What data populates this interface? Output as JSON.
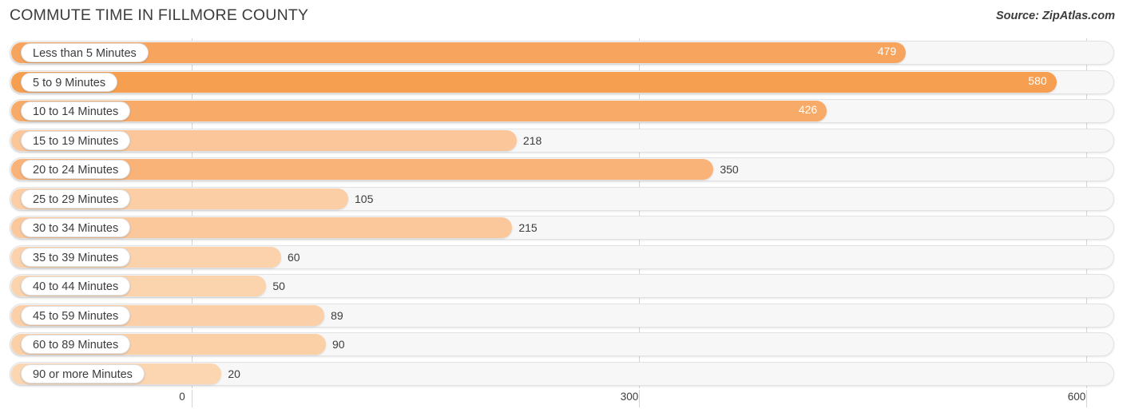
{
  "header": {
    "title": "COMMUTE TIME IN FILLMORE COUNTY",
    "source": "Source: ZipAtlas.com"
  },
  "chart_data": {
    "type": "bar",
    "orientation": "horizontal",
    "title": "COMMUTE TIME IN FILLMORE COUNTY",
    "subtitle": "Source: ZipAtlas.com",
    "xlabel": "",
    "ylabel": "",
    "xlim": [
      0,
      600
    ],
    "xticks": [
      0,
      300,
      600
    ],
    "xtick_labels": [
      "0",
      "300",
      "600"
    ],
    "grid": true,
    "legend": false,
    "categories": [
      "Less than 5 Minutes",
      "5 to 9 Minutes",
      "10 to 14 Minutes",
      "15 to 19 Minutes",
      "20 to 24 Minutes",
      "25 to 29 Minutes",
      "30 to 34 Minutes",
      "35 to 39 Minutes",
      "40 to 44 Minutes",
      "45 to 59 Minutes",
      "60 to 89 Minutes",
      "90 or more Minutes"
    ],
    "values": [
      479,
      580,
      426,
      218,
      350,
      105,
      215,
      60,
      50,
      89,
      90,
      20
    ],
    "value_labels": [
      "479",
      "580",
      "426",
      "218",
      "350",
      "105",
      "215",
      "60",
      "50",
      "89",
      "90",
      "20"
    ],
    "bar_colors": [
      "#F7A55E",
      "#F79F51",
      "#F8AB69",
      "#FBC79A",
      "#F9B379",
      "#FBCEA5",
      "#FBC89B",
      "#FBD2AB",
      "#FBD3AD",
      "#FBD0A8",
      "#FBD0A7",
      "#FCD5B1"
    ],
    "label_inside": [
      true,
      true,
      true,
      false,
      false,
      false,
      false,
      false,
      false,
      false,
      false,
      false
    ]
  },
  "colors": {
    "track": "#F7F7F7",
    "track_border": "#E2E2E2",
    "gridline": "#D4D4D4",
    "text": "#3C3C3C",
    "value_inside_text": "#FFFFFF"
  }
}
